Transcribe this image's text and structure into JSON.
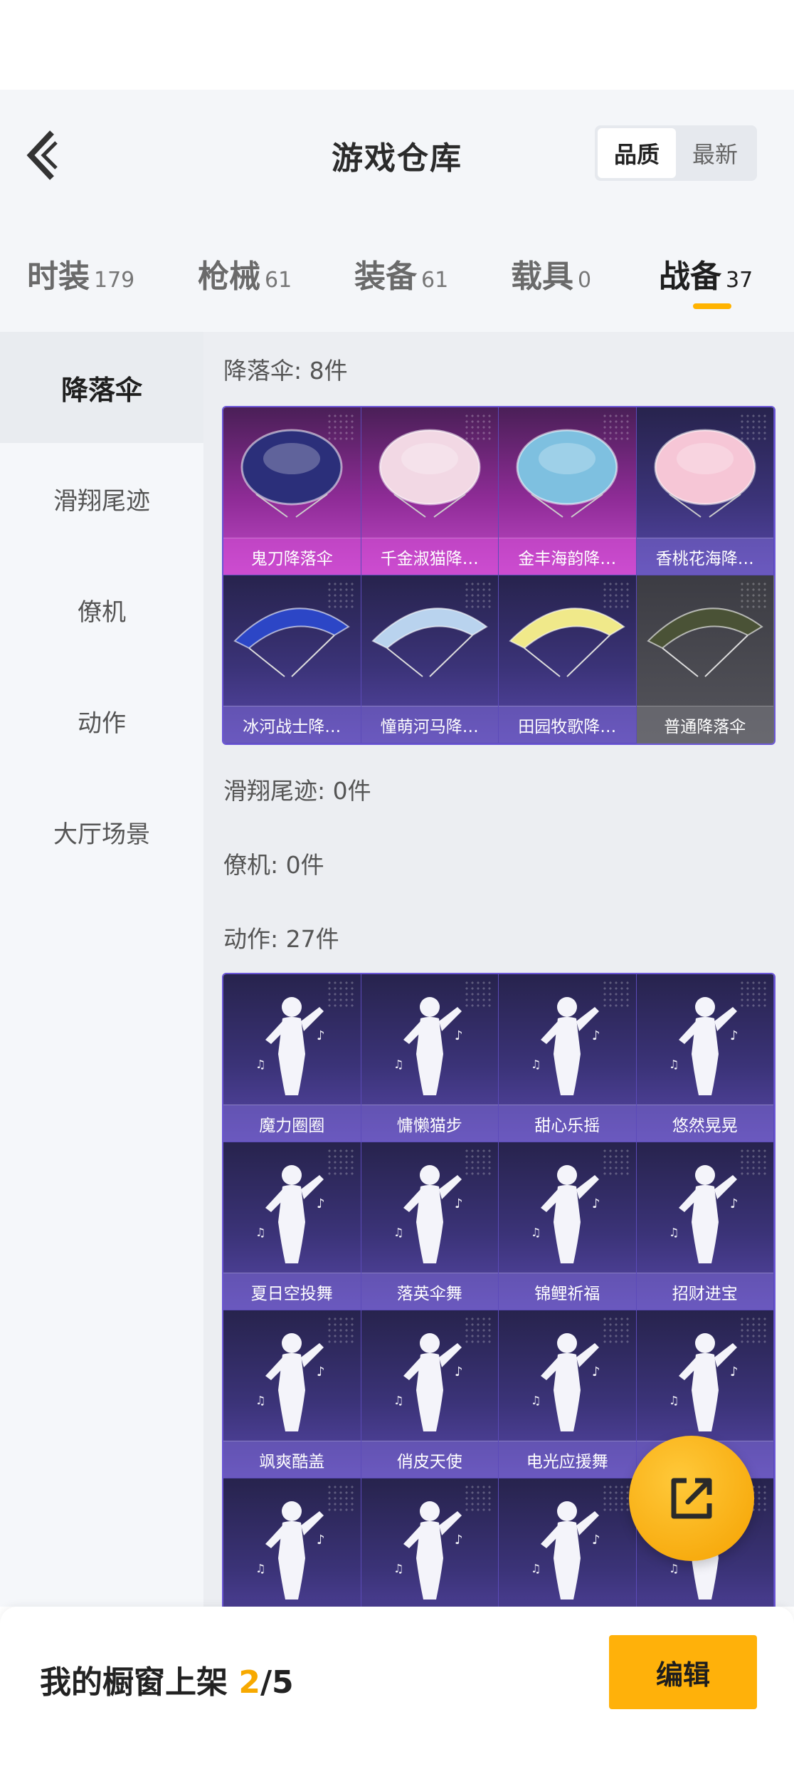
{
  "header": {
    "title": "游戏仓库",
    "sort": {
      "quality": "品质",
      "newest": "最新",
      "selected": "品质"
    }
  },
  "tabs": [
    {
      "label": "时装",
      "count": "179"
    },
    {
      "label": "枪械",
      "count": "61"
    },
    {
      "label": "装备",
      "count": "61"
    },
    {
      "label": "载具",
      "count": "0"
    },
    {
      "label": "战备",
      "count": "37",
      "active": true
    }
  ],
  "sidebar": [
    {
      "label": "降落伞",
      "active": true
    },
    {
      "label": "滑翔尾迹"
    },
    {
      "label": "僚机"
    },
    {
      "label": "动作"
    },
    {
      "label": "大厅场景"
    }
  ],
  "sections": {
    "parachute": {
      "title": "降落伞: 8件"
    },
    "trail": {
      "title": "滑翔尾迹: 0件"
    },
    "wingman": {
      "title": "僚机: 0件"
    },
    "emote": {
      "title": "动作: 27件"
    }
  },
  "parachutes": [
    {
      "name": "鬼刀降落伞",
      "rarity": "pink",
      "color": "#2b2f7a"
    },
    {
      "name": "千金淑猫降…",
      "rarity": "pink",
      "color": "#f2d8e4"
    },
    {
      "name": "金丰海韵降…",
      "rarity": "pink",
      "color": "#7ec0e0"
    },
    {
      "name": "香桃花海降…",
      "rarity": "purple",
      "color": "#f6c6d6"
    },
    {
      "name": "冰河战士降…",
      "rarity": "purple",
      "color": "#2c46c6"
    },
    {
      "name": "憧萌河马降…",
      "rarity": "purple",
      "color": "#b9d3ee"
    },
    {
      "name": "田园牧歌降…",
      "rarity": "purple",
      "color": "#f0e98a"
    },
    {
      "name": "普通降落伞",
      "rarity": "grey",
      "color": "#4a5236"
    }
  ],
  "emotes": [
    {
      "name": "魔力圈圈"
    },
    {
      "name": "慵懒猫步"
    },
    {
      "name": "甜心乐摇"
    },
    {
      "name": "悠然晃晃"
    },
    {
      "name": "夏日空投舞"
    },
    {
      "name": "落英伞舞"
    },
    {
      "name": "锦鲤祈福"
    },
    {
      "name": "招财进宝"
    },
    {
      "name": "飒爽酷盖"
    },
    {
      "name": "俏皮天使"
    },
    {
      "name": "电光应援舞"
    },
    {
      "name": ""
    },
    {
      "name": ""
    },
    {
      "name": ""
    },
    {
      "name": ""
    },
    {
      "name": ""
    }
  ],
  "bottom": {
    "shelf_label": "我的橱窗上架 ",
    "shelf_current": "2",
    "shelf_total": "/5",
    "edit_label": "编辑"
  },
  "colors": {
    "accent": "#ffb10a",
    "purple_border": "#6a55d6"
  }
}
